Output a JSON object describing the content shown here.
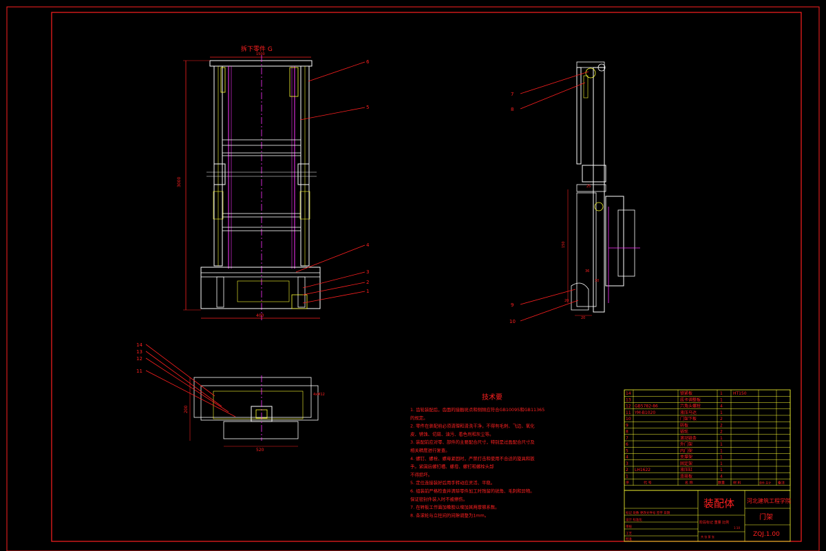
{
  "drawing": {
    "front_view": {
      "title": "拆下零件 G",
      "dim_top": "1500",
      "dim_height": "3000",
      "dim_bottom": "400"
    },
    "side_view": {
      "dim_a": "25",
      "dim_b": "30",
      "dim_c": "150",
      "dim_d": "20",
      "dim_e": "36",
      "dim_f": "20"
    },
    "bottom_view": {
      "dim_h": "200",
      "dim_w": "520",
      "note": "4xM12"
    },
    "balloons": {
      "b1": "1",
      "b2": "2",
      "b3": "3",
      "b4": "4",
      "b5": "5",
      "b6": "6",
      "b7": "7",
      "b8": "8",
      "b9": "9",
      "b10": "10",
      "b11": "11",
      "b12": "12",
      "b13": "13",
      "b14": "14"
    }
  },
  "tech_req": {
    "title": "技术要",
    "lines": [
      "1. 齿轮装配后，齿面的接触斑点和侧隙应符合GB10095和GB11365",
      "的规定。",
      "2. 零件在装配前必须清理和清洗干净，不得有毛刺、飞边、氧化",
      "皮、锈蚀、切屑、油污、着色剂和灰尘等。",
      "3. 装配前应对零、部件的主要配合尺寸，特别是过盈配合尺寸及",
      "相关精度进行复查。",
      "4. 螺钉、螺栓、螺母紧固时，严禁打击和使用不合适的旋具和扳",
      "手。紧固后螺钉槽、螺母、螺钉和螺栓头部",
      "不得损坏。",
      "5. 定位连接装好后用手转动应灵活、平稳。",
      "6. 组装前严格检查并清除零件加工时残留的锐角、毛刺和异物。",
      "保证密封件装入时不被擦伤。",
      "7. 在转板工作面加橡胶以增加其两摩擦系数。",
      "8. 各滚轮与立柱间的间隙调整为1mm。"
    ]
  },
  "bom": {
    "rows": [
      {
        "no": "14",
        "code": "",
        "name": "锁紧板",
        "qty": "1",
        "material": "HT150"
      },
      {
        "no": "13",
        "code": "",
        "name": "底卡调整板",
        "qty": "1",
        "material": ""
      },
      {
        "no": "12",
        "code": "GB5782-86",
        "name": "六角头螺栓",
        "qty": "4",
        "material": ""
      },
      {
        "no": "11",
        "code": "YM-B1020",
        "name": "液压马达",
        "qty": "1",
        "material": ""
      },
      {
        "no": "10",
        "code": "",
        "name": "门架下板",
        "qty": "2",
        "material": ""
      },
      {
        "no": "9",
        "code": "",
        "name": "转板",
        "qty": "2",
        "material": ""
      },
      {
        "no": "8",
        "code": "",
        "name": "链轮",
        "qty": "2",
        "material": ""
      },
      {
        "no": "7",
        "code": "",
        "name": "滚动链条",
        "qty": "1",
        "material": ""
      },
      {
        "no": "6",
        "code": "",
        "name": "外门架",
        "qty": "1",
        "material": ""
      },
      {
        "no": "5",
        "code": "",
        "name": "内门架",
        "qty": "1",
        "material": ""
      },
      {
        "no": "4",
        "code": "",
        "name": "支撑架",
        "qty": "1",
        "material": ""
      },
      {
        "no": "3",
        "code": "",
        "name": "固定架",
        "qty": "1",
        "material": ""
      },
      {
        "no": "2",
        "code": "LH1622",
        "name": "液压缸",
        "qty": "1",
        "material": ""
      },
      {
        "no": "1",
        "code": "",
        "name": "连接板",
        "qty": "4",
        "material": ""
      }
    ],
    "header": {
      "no": "序",
      "code": "代  号",
      "name": "名  称",
      "qty": "数量",
      "material": "材  料",
      "weight": "单件 总计",
      "note": "备注"
    }
  },
  "title_block": {
    "type": "装配体",
    "school": "河北建筑工程学院",
    "part": "门架",
    "code": "ZQJ.1.00",
    "rows": [
      "标记 处数 更改文件号 签字 日期",
      "设计 标准化",
      "审核",
      "工艺",
      "批准"
    ],
    "stage": "阶段标记 重量 比例",
    "ratio": "1:10",
    "sheet": "共 张 第 张"
  }
}
